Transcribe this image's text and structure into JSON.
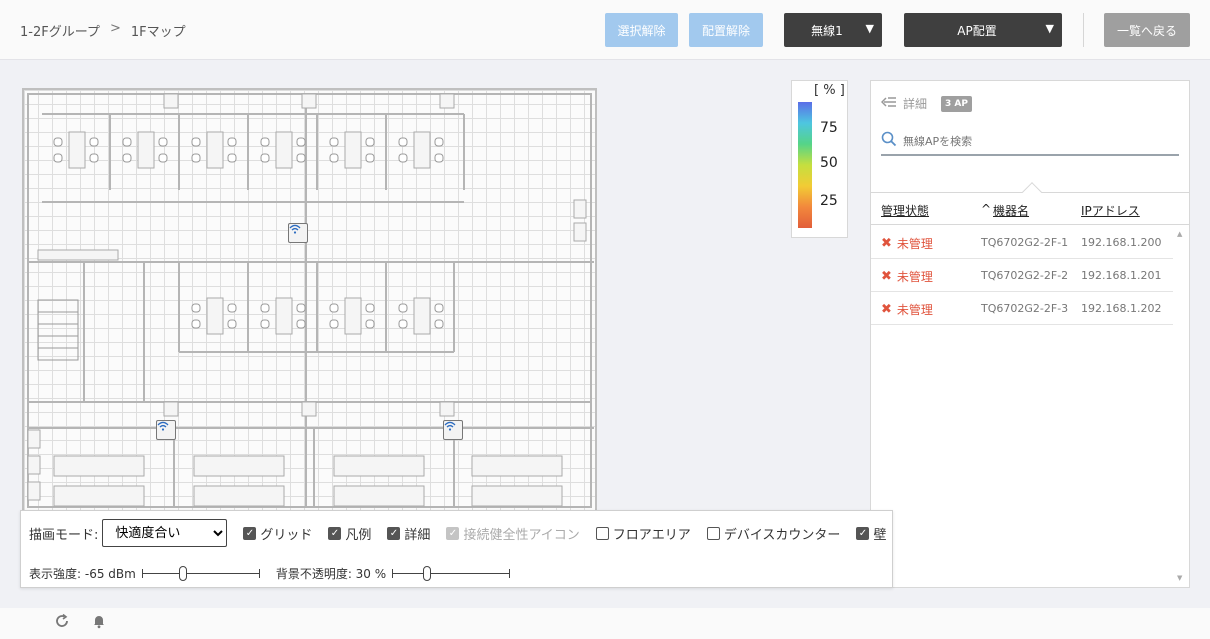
{
  "header": {
    "breadcrumb": {
      "group": "1-2Fグループ",
      "separator": ">",
      "map": "1Fマップ"
    },
    "buttons": {
      "deselect": "選択解除",
      "unplace": "配置解除",
      "wireless_select": "無線1",
      "ap_placement": "AP配置",
      "back": "一覧へ戻る"
    }
  },
  "legend": {
    "unit": "[ % ]",
    "ticks": [
      "75",
      "50",
      "25"
    ]
  },
  "panel": {
    "title": "詳細",
    "ap_count": "3 AP",
    "search_placeholder": "無線APを検索",
    "columns": {
      "status": "管理状態",
      "sort_indicator": "^",
      "device": "機器名",
      "ip": "IPアドレス"
    },
    "rows": [
      {
        "status": "未管理",
        "device": "TQ6702G2-2F-1",
        "ip": "192.168.1.200"
      },
      {
        "status": "未管理",
        "device": "TQ6702G2-2F-2",
        "ip": "192.168.1.201"
      },
      {
        "status": "未管理",
        "device": "TQ6702G2-2F-3",
        "ip": "192.168.1.202"
      }
    ]
  },
  "controls": {
    "mode_label": "描画モード:",
    "mode_value": "快適度合い",
    "checkboxes": {
      "grid": "グリッド",
      "legend": "凡例",
      "detail": "詳細",
      "health_icon": "接続健全性アイコン",
      "floor_area": "フロアエリア",
      "device_counter": "デバイスカウンター",
      "wall": "壁"
    },
    "strength_label": "表示強度: -65 dBm",
    "opacity_label": "背景不透明度: 30 %",
    "strength_level": 0.35,
    "opacity_level": 0.3
  },
  "icons": {
    "ap": "wifi-icon",
    "refresh": "refresh-icon",
    "notify": "bell-icon",
    "search": "search-icon",
    "collapse": "collapse-list-icon",
    "status": "x-icon"
  },
  "colors": {
    "accent_light": "#a2c9ee",
    "dark_button": "#3f3f3f",
    "status_error": "#e0543d"
  }
}
